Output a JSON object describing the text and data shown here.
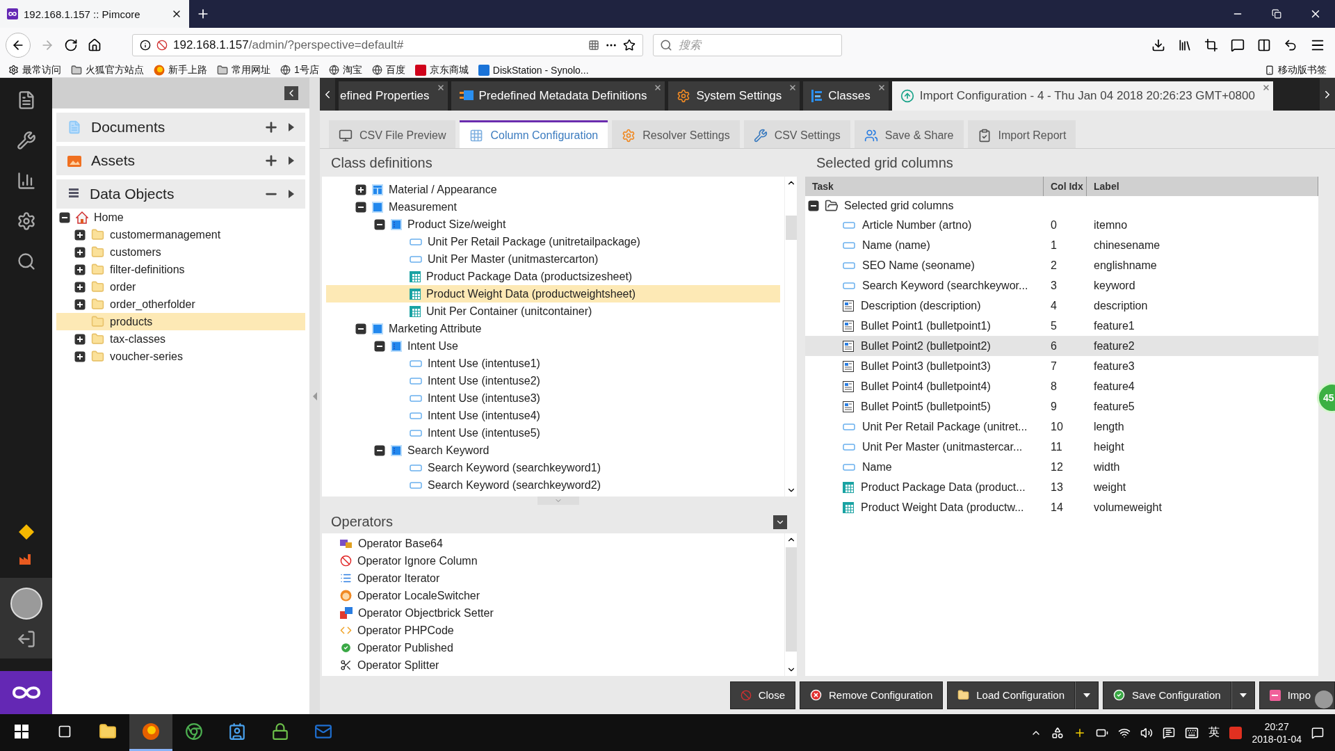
{
  "browser": {
    "tab_title": "192.168.1.157 :: Pimcore",
    "url_host": "192.168.1.157",
    "url_path": "/admin/?perspective=default#",
    "search_placeholder": "搜索",
    "bookmarks": [
      {
        "label": "最常访问",
        "kind": "gear"
      },
      {
        "label": "火狐官方站点",
        "kind": "folder"
      },
      {
        "label": "新手上路",
        "kind": "browser"
      },
      {
        "label": "常用网址",
        "kind": "folder"
      },
      {
        "label": "1号店",
        "kind": "globe"
      },
      {
        "label": "淘宝",
        "kind": "globe"
      },
      {
        "label": "百度",
        "kind": "globe"
      },
      {
        "label": "京东商城",
        "kind": "shop"
      },
      {
        "label": "DiskStation - Synolo...",
        "kind": "storage"
      }
    ],
    "mobile_bookmarks": "移动版书签"
  },
  "nav_panels": [
    {
      "label": "Documents",
      "kind": "document",
      "expanded": false
    },
    {
      "label": "Assets",
      "kind": "asset",
      "expanded": false
    },
    {
      "label": "Data Objects",
      "kind": "objects",
      "expanded": true
    }
  ],
  "object_tree": {
    "label": "Home",
    "expanded": true,
    "children": [
      {
        "label": "customermanagement",
        "has_children": true,
        "selected": false
      },
      {
        "label": "customers",
        "has_children": true,
        "selected": false
      },
      {
        "label": "filter-definitions",
        "has_children": true,
        "selected": false
      },
      {
        "label": "order",
        "has_children": true,
        "selected": false
      },
      {
        "label": "order_otherfolder",
        "has_children": true,
        "selected": false
      },
      {
        "label": "products",
        "has_children": false,
        "selected": true
      },
      {
        "label": "tax-classes",
        "has_children": true,
        "selected": false
      },
      {
        "label": "voucher-series",
        "has_children": true,
        "selected": false
      }
    ]
  },
  "main_tabs": [
    {
      "label": "efined Properties",
      "kind": "none",
      "selected": false
    },
    {
      "label": "Predefined Metadata Definitions",
      "kind": "metadata",
      "selected": false
    },
    {
      "label": "System Settings",
      "kind": "gear",
      "selected": false
    },
    {
      "label": "Classes",
      "kind": "classes",
      "selected": false
    },
    {
      "label": "Import Configuration - 4 - Thu Jan 04 2018 20:26:23 GMT+0800",
      "kind": "import",
      "selected": true
    }
  ],
  "sub_tabs": [
    {
      "label": "CSV File Preview",
      "kind": "preview",
      "selected": false
    },
    {
      "label": "Column Configuration",
      "kind": "grid",
      "selected": true
    },
    {
      "label": "Resolver Settings",
      "kind": "gear",
      "selected": false
    },
    {
      "label": "CSV Settings",
      "kind": "wrench",
      "selected": false
    },
    {
      "label": "Save & Share",
      "kind": "users",
      "selected": false
    },
    {
      "label": "Import Report",
      "kind": "report",
      "selected": false
    }
  ],
  "class_definitions": {
    "title": "Class definitions",
    "items": [
      {
        "label": "Material / Appearance",
        "kind": "layout",
        "expanded": false,
        "selected": false
      },
      {
        "label": "Measurement",
        "kind": "panel",
        "expanded": true,
        "selected": false,
        "children": [
          {
            "label": "Product Size/weight",
            "kind": "fieldset",
            "expanded": true,
            "selected": false,
            "children": [
              {
                "label": "Unit Per Retail Package (unitretailpackage)",
                "kind": "input",
                "selected": false
              },
              {
                "label": "Unit Per Master (unitmastercarton)",
                "kind": "input",
                "selected": false
              },
              {
                "label": "Product Package Data (productsizesheet)",
                "kind": "table",
                "selected": false
              },
              {
                "label": "Product Weight Data (productweightsheet)",
                "kind": "table",
                "selected": true
              },
              {
                "label": "Unit Per Container (unitcontainer)",
                "kind": "table",
                "selected": false
              }
            ]
          }
        ]
      },
      {
        "label": "Marketing Attribute",
        "kind": "panel",
        "expanded": true,
        "selected": false,
        "children": [
          {
            "label": "Intent Use",
            "kind": "fieldset",
            "expanded": true,
            "selected": false,
            "children": [
              {
                "label": "Intent Use (intentuse1)",
                "kind": "input",
                "selected": false
              },
              {
                "label": "Intent Use (intentuse2)",
                "kind": "input",
                "selected": false
              },
              {
                "label": "Intent Use (intentuse3)",
                "kind": "input",
                "selected": false
              },
              {
                "label": "Intent Use (intentuse4)",
                "kind": "input",
                "selected": false
              },
              {
                "label": "Intent Use (intentuse5)",
                "kind": "input",
                "selected": false
              }
            ]
          },
          {
            "label": "Search Keyword",
            "kind": "fieldset",
            "expanded": true,
            "selected": false,
            "children": [
              {
                "label": "Search Keyword (searchkeyword1)",
                "kind": "input",
                "selected": false
              },
              {
                "label": "Search Keyword (searchkeyword2)",
                "kind": "input",
                "selected": false
              }
            ]
          }
        ]
      }
    ]
  },
  "operators": {
    "title": "Operators",
    "items": [
      {
        "label": "Operator Base64",
        "kind": "base64"
      },
      {
        "label": "Operator Ignore Column",
        "kind": "ignore"
      },
      {
        "label": "Operator Iterator",
        "kind": "iterator"
      },
      {
        "label": "Operator LocaleSwitcher",
        "kind": "locale"
      },
      {
        "label": "Operator Objectbrick Setter",
        "kind": "objectbrick"
      },
      {
        "label": "Operator PHPCode",
        "kind": "php"
      },
      {
        "label": "Operator Published",
        "kind": "published"
      },
      {
        "label": "Operator Splitter",
        "kind": "splitter"
      }
    ]
  },
  "grid": {
    "title": "Selected grid columns",
    "columns": [
      "Task",
      "Col Idx",
      "Label"
    ],
    "root": "Selected grid columns",
    "expanded": true,
    "rows": [
      {
        "task": "Article Number (artno)",
        "kind": "input",
        "index": "0",
        "label": "itemno",
        "selected": false
      },
      {
        "task": "Name (name)",
        "kind": "input",
        "index": "1",
        "label": "chinesename",
        "selected": false
      },
      {
        "task": "SEO Name (seoname)",
        "kind": "input",
        "index": "2",
        "label": "englishname",
        "selected": false
      },
      {
        "task": "Search Keyword (searchkeywor...",
        "kind": "input",
        "index": "3",
        "label": "keyword",
        "selected": false
      },
      {
        "task": "Description (description)",
        "kind": "textarea",
        "index": "4",
        "label": "description",
        "selected": false
      },
      {
        "task": "Bullet Point1 (bulletpoint1)",
        "kind": "textarea",
        "index": "5",
        "label": "feature1",
        "selected": false
      },
      {
        "task": "Bullet Point2 (bulletpoint2)",
        "kind": "textarea",
        "index": "6",
        "label": "feature2",
        "selected": true
      },
      {
        "task": "Bullet Point3 (bulletpoint3)",
        "kind": "textarea",
        "index": "7",
        "label": "feature3",
        "selected": false
      },
      {
        "task": "Bullet Point4 (bulletpoint4)",
        "kind": "textarea",
        "index": "8",
        "label": "feature4",
        "selected": false
      },
      {
        "task": "Bullet Point5 (bulletpoint5)",
        "kind": "textarea",
        "index": "9",
        "label": "feature5",
        "selected": false
      },
      {
        "task": "Unit Per Retail Package (unitret...",
        "kind": "input",
        "index": "10",
        "label": "length",
        "selected": false
      },
      {
        "task": "Unit Per Master (unitmastercar...",
        "kind": "input",
        "index": "11",
        "label": "height",
        "selected": false
      },
      {
        "task": "Name",
        "kind": "input",
        "index": "12",
        "label": "width",
        "selected": false
      },
      {
        "task": "Product Package Data (product...",
        "kind": "table",
        "index": "13",
        "label": "weight",
        "selected": false
      },
      {
        "task": "Product Weight Data (productw...",
        "kind": "table",
        "index": "14",
        "label": "volumeweight",
        "selected": false
      }
    ]
  },
  "buttons": [
    {
      "label": "Close",
      "kind": "ban",
      "split": false
    },
    {
      "label": "Remove Configuration",
      "kind": "remove",
      "split": false
    },
    {
      "label": "Load Configuration",
      "kind": "folder",
      "split": true
    },
    {
      "label": "Save Configuration",
      "kind": "check",
      "split": true
    },
    {
      "label": "Impo",
      "kind": "import",
      "split": false
    }
  ],
  "badge": "45",
  "taskbar": {
    "apps": [
      {
        "kind": "explorer",
        "active": false
      },
      {
        "kind": "firefox",
        "active": true
      },
      {
        "kind": "chrome",
        "active": false
      },
      {
        "kind": "contacts",
        "active": false
      },
      {
        "kind": "lock",
        "active": false
      },
      {
        "kind": "mail",
        "active": false
      }
    ],
    "ime": "英",
    "time": "20:27",
    "date": "2018-01-04"
  }
}
